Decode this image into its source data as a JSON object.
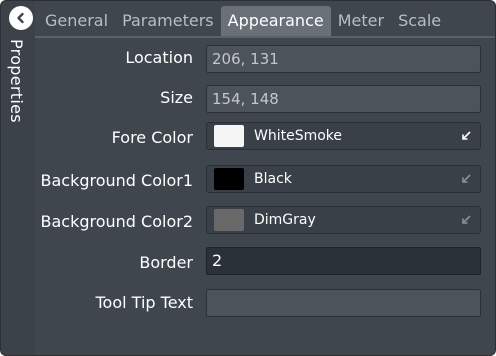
{
  "side": {
    "title": "Properties",
    "back_icon": "chevron-left-icon"
  },
  "tabs": [
    {
      "label": "General",
      "active": false
    },
    {
      "label": "Parameters",
      "active": false
    },
    {
      "label": "Appearance",
      "active": true
    },
    {
      "label": "Meter",
      "active": false
    },
    {
      "label": "Scale",
      "active": false
    }
  ],
  "properties": {
    "location": {
      "label": "Location",
      "value": "206, 131"
    },
    "size": {
      "label": "Size",
      "value": "154, 148"
    },
    "fore_color": {
      "label": "Fore Color",
      "value": "WhiteSmoke",
      "swatch": "#f5f5f5"
    },
    "background_color1": {
      "label": "Background Color1",
      "value": "Black",
      "swatch": "#000000"
    },
    "background_color2": {
      "label": "Background Color2",
      "value": "DimGray",
      "swatch": "#696969"
    },
    "border": {
      "label": "Border",
      "value": "2"
    },
    "tooltip": {
      "label": "Tool Tip Text",
      "value": ""
    }
  },
  "colors": {
    "panel_bg": "#3f464e",
    "active_tab": "#6a7077",
    "field_bg": "#4c535b",
    "active_field_bg": "#2a3139"
  }
}
